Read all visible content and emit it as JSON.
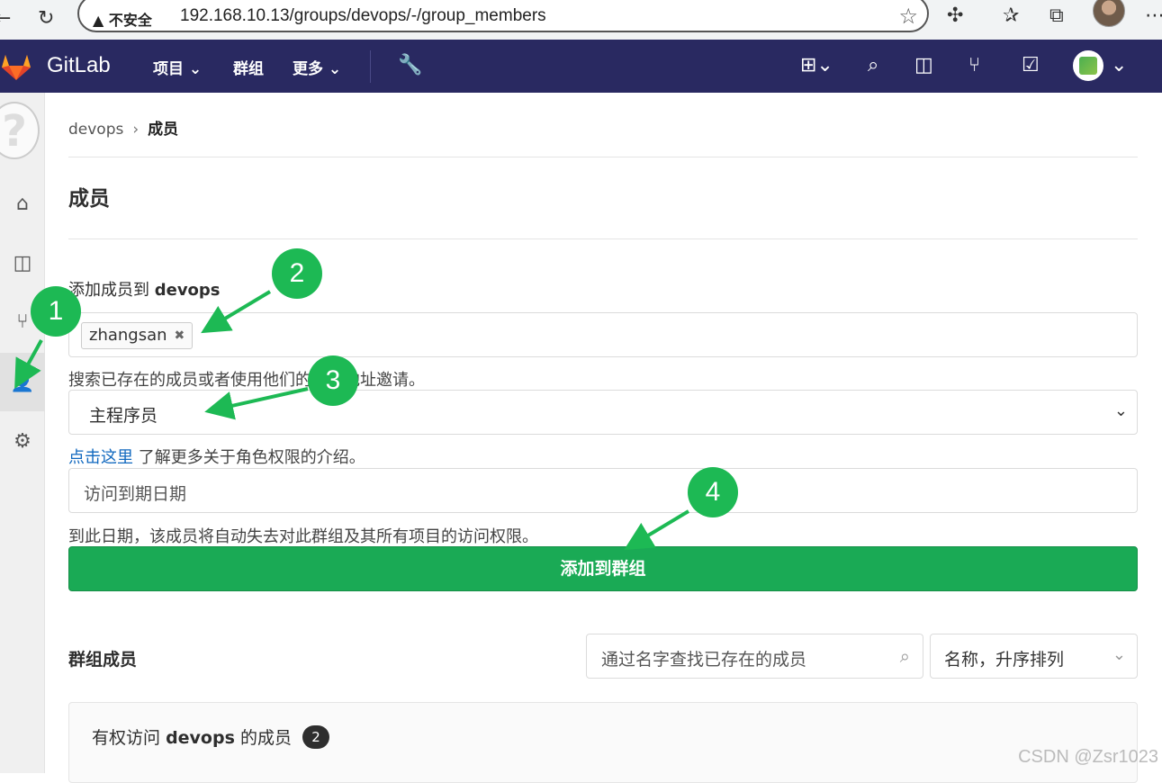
{
  "browser": {
    "security_label": "不安全",
    "url": "192.168.10.13/groups/devops/-/group_members"
  },
  "header": {
    "brand": "GitLab",
    "nav": [
      "项目",
      "群组",
      "更多"
    ]
  },
  "breadcrumb": {
    "parent": "devops",
    "current": "成员"
  },
  "page": {
    "title": "成员",
    "add_label_prefix": "添加成员到",
    "add_label_group": "devops",
    "selected_user": "zhangsan",
    "search_help": "搜索已存在的成员或者使用他们的邮箱地址邀请。",
    "role_value": "主程序员",
    "role_link": "点击这里",
    "role_help": "了解更多关于角色权限的介绍。",
    "expiry_placeholder": "访问到期日期",
    "expiry_help": "到此日期，该成员将自动失去对此群组及其所有项目的访问权限。",
    "submit_label": "添加到群组"
  },
  "members": {
    "title": "群组成员",
    "search_placeholder": "通过名字查找已存在的成员",
    "sort_value": "名称，升序排列",
    "panel_prefix": "有权访问",
    "panel_group": "devops",
    "panel_suffix": "的成员",
    "count": "2"
  },
  "annotations": [
    "1",
    "2",
    "3",
    "4"
  ],
  "watermark": "CSDN @Zsr1023",
  "colors": {
    "header_bg": "#292961",
    "submit_green": "#1aaa55",
    "annotation_green": "#1db954",
    "link_blue": "#1068bf"
  }
}
